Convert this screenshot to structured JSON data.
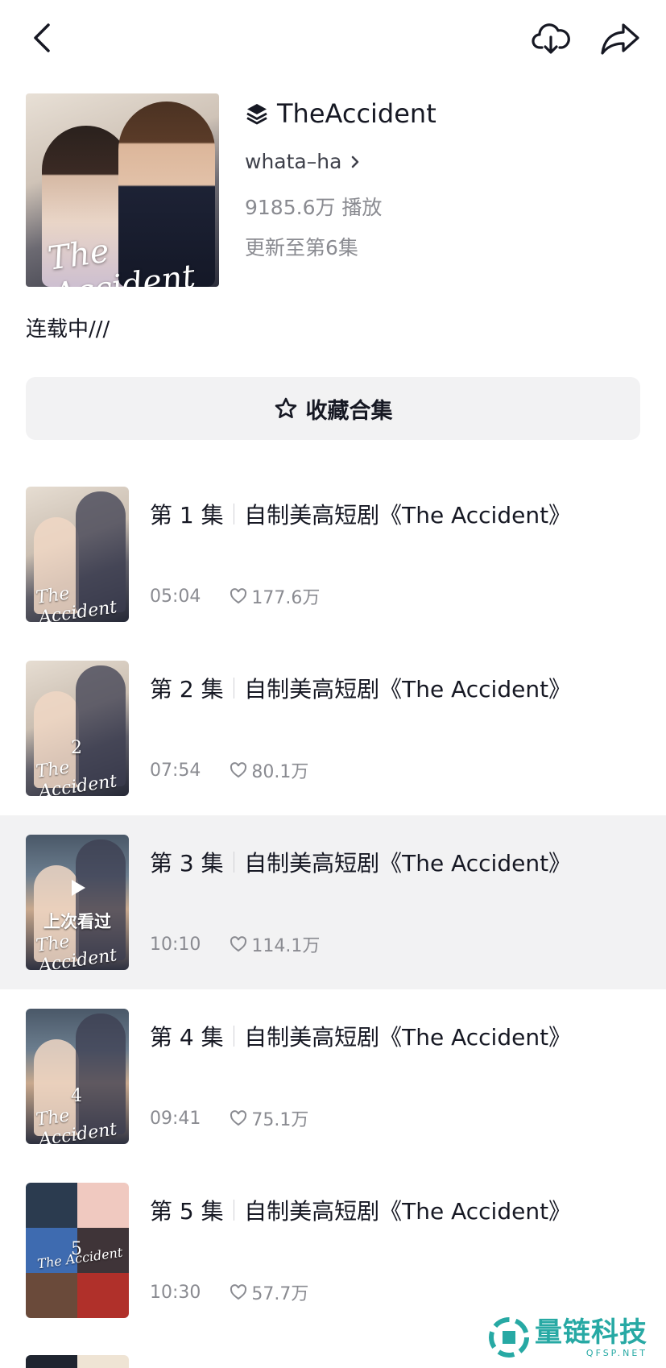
{
  "topbar": {
    "back_icon": "chevron-left-icon",
    "download_icon": "cloud-download-icon",
    "share_icon": "share-arrow-icon"
  },
  "collection": {
    "icon": "layers-icon",
    "title": "TheAccident",
    "author": "whata–ha",
    "plays": "9185.6万 播放",
    "updated": "更新至第6集",
    "description": "连载中///",
    "cover_script": "The Accident"
  },
  "favorite_button": {
    "icon": "star-icon",
    "label": "收藏合集"
  },
  "episodes": [
    {
      "label": "第 1 集",
      "title": "自制美高短剧《The Accident》",
      "duration": "05:04",
      "likes": "177.6万"
    },
    {
      "label": "第 2 集",
      "title": "自制美高短剧《The Accident》",
      "duration": "07:54",
      "likes": "80.1万",
      "thumb_num": "2"
    },
    {
      "label": "第 3 集",
      "title": "自制美高短剧《The Accident》",
      "duration": "10:10",
      "likes": "114.1万",
      "last_watched": "上次看过"
    },
    {
      "label": "第 4 集",
      "title": "自制美高短剧《The Accident》",
      "duration": "09:41",
      "likes": "75.1万",
      "thumb_num": "4"
    },
    {
      "label": "第 5 集",
      "title": "自制美高短剧《The Accident》",
      "duration": "10:30",
      "likes": "57.7万",
      "thumb_num": "5"
    }
  ],
  "thumb_script": "The Accident",
  "watermark": {
    "cn": "量链科技",
    "en": "QFSP.NET"
  },
  "colors": {
    "active_row": "#f2f2f3",
    "watermark": "#27a9a4",
    "text": "#161823",
    "secondary": "#8a8b91"
  }
}
